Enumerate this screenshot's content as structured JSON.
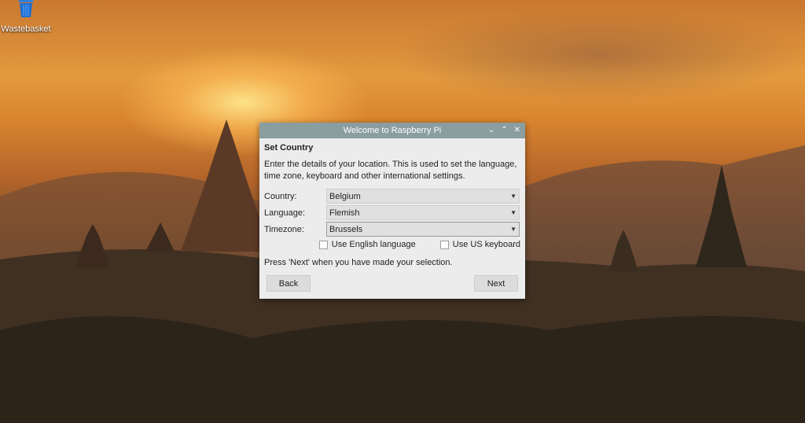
{
  "desktop": {
    "icons": [
      {
        "label": "Wastebasket"
      }
    ]
  },
  "dialog": {
    "title": "Welcome to Raspberry Pi",
    "heading": "Set Country",
    "description": "Enter the details of your location. This is used to set the language, time zone, keyboard and other international settings.",
    "fields": {
      "country": {
        "label": "Country:",
        "value": "Belgium"
      },
      "language": {
        "label": "Language:",
        "value": "Flemish"
      },
      "timezone": {
        "label": "Timezone:",
        "value": "Brussels"
      }
    },
    "checkboxes": {
      "english": {
        "label": "Use English language",
        "checked": false
      },
      "us_keyboard": {
        "label": "Use US keyboard",
        "checked": false
      }
    },
    "footer_text": "Press 'Next' when you have made your selection.",
    "buttons": {
      "back": "Back",
      "next": "Next"
    }
  },
  "colors": {
    "titlebar": "#8a9ea0",
    "dialog_bg": "#ececec"
  }
}
